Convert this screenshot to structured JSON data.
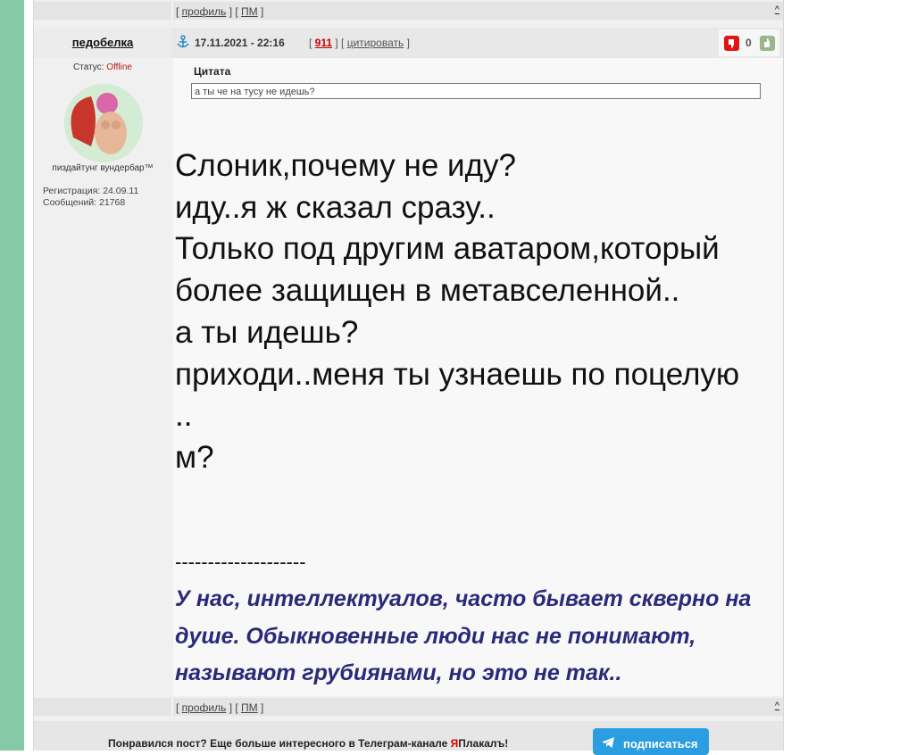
{
  "top_bar": {
    "profile_label": "профиль",
    "pm_label": "ПМ",
    "to_top_label": "^"
  },
  "post": {
    "author": "педобелка",
    "date": "17.11.2021 - 22:16",
    "post_number": "911",
    "quote_label": "цитировать",
    "rating": "0",
    "status_label": "Статус:",
    "status_value": "Offline",
    "avatar_caption": "пиздайтунг вундербар™",
    "registration": "Регистрация: 24.09.11",
    "messages": "Сообщений: 21768",
    "quote_title": "Цитата",
    "quote_text": "а ты че на тусу не идешь?",
    "body_lines": [
      "Слоник,почему не иду?",
      "иду..я ж сказал сразу..",
      "Только под другим аватаром,который",
      "более защищен в метавселенной..",
      "а ты идешь?",
      "приходи..меня ты узнаешь по поцелую",
      "..",
      "м?"
    ],
    "signature_separator": "--------------------",
    "signature": "У нас, интеллектуалов, часто бывает скверно на душе. Обыкновенные люди нас не понимают, называют грубиянами, но это не так.."
  },
  "bottom_bar": {
    "profile_label": "профиль",
    "pm_label": "ПМ",
    "to_top_label": "^"
  },
  "promo": {
    "text_before": "Понравился пост? Еще больше интересного в Телеграм-канале ",
    "brand_ya": "Я",
    "brand_rest": "Плакалъ!",
    "subscribe_label": "подписаться"
  },
  "colors": {
    "left_strip": "#86c9a6",
    "status_offline": "#b02020",
    "signature": "#2a2a7a",
    "subscribe_button": "#2a9ee0",
    "vote_down": "#e01616"
  }
}
